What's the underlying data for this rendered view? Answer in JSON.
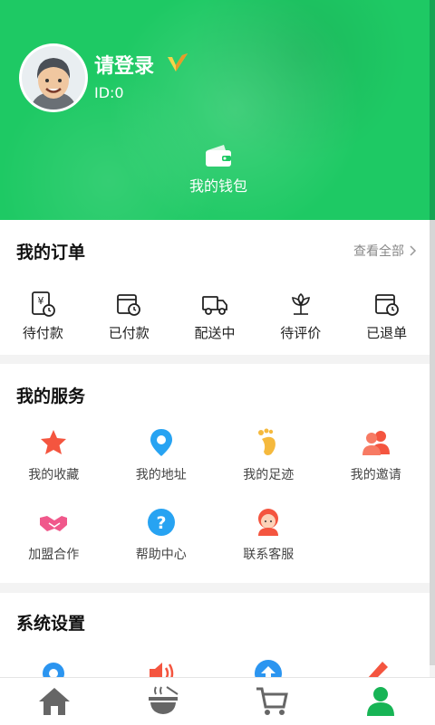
{
  "header": {
    "login_label": "请登录",
    "id_label": "ID:0",
    "wallet_label": "我的钱包"
  },
  "orders": {
    "title": "我的订单",
    "view_all": "查看全部",
    "items": [
      {
        "label": "待付款",
        "icon": "pending-payment-icon"
      },
      {
        "label": "已付款",
        "icon": "paid-icon"
      },
      {
        "label": "配送中",
        "icon": "delivery-truck-icon"
      },
      {
        "label": "待评价",
        "icon": "review-flower-icon"
      },
      {
        "label": "已退单",
        "icon": "refund-icon"
      }
    ]
  },
  "services": {
    "title": "我的服务",
    "items": [
      {
        "label": "我的收藏",
        "icon": "star-icon",
        "color": "#f4553f"
      },
      {
        "label": "我的地址",
        "icon": "location-pin-icon",
        "color": "#27a3f2"
      },
      {
        "label": "我的足迹",
        "icon": "footprint-icon",
        "color": "#f5b93d"
      },
      {
        "label": "我的邀请",
        "icon": "users-icon",
        "color": "#f4553f"
      },
      {
        "label": "加盟合作",
        "icon": "handshake-icon",
        "color": "#f0588b"
      },
      {
        "label": "帮助中心",
        "icon": "help-icon",
        "color": "#27a3f2"
      },
      {
        "label": "联系客服",
        "icon": "customer-service-icon",
        "color": "#f4553f"
      }
    ]
  },
  "settings": {
    "title": "系统设置",
    "items": [
      {
        "icon": "gear-icon",
        "color": "#2b95f0"
      },
      {
        "icon": "speaker-icon",
        "color": "#f4553f"
      },
      {
        "icon": "upload-icon",
        "color": "#2b95f0"
      },
      {
        "icon": "pencil-icon",
        "color": "#f4553f"
      }
    ]
  },
  "tabbar": {
    "items": [
      {
        "icon": "home-icon",
        "active": false
      },
      {
        "icon": "bowl-icon",
        "active": false
      },
      {
        "icon": "cart-icon",
        "active": false
      },
      {
        "icon": "profile-icon",
        "active": true
      }
    ]
  },
  "colors": {
    "brand_green": "#1ec964",
    "tab_inactive": "#666666",
    "tab_active": "#17b455"
  }
}
